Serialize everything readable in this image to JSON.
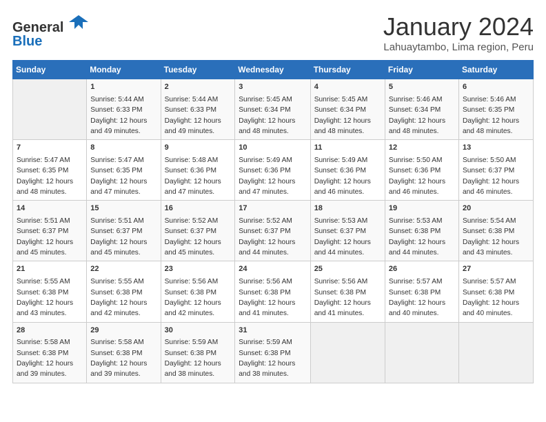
{
  "logo": {
    "line1": "General",
    "line2": "Blue"
  },
  "header": {
    "title": "January 2024",
    "subtitle": "Lahuaytambo, Lima region, Peru"
  },
  "columns": [
    "Sunday",
    "Monday",
    "Tuesday",
    "Wednesday",
    "Thursday",
    "Friday",
    "Saturday"
  ],
  "weeks": [
    [
      {
        "day": "",
        "info": ""
      },
      {
        "day": "1",
        "info": "Sunrise: 5:44 AM\nSunset: 6:33 PM\nDaylight: 12 hours\nand 49 minutes."
      },
      {
        "day": "2",
        "info": "Sunrise: 5:44 AM\nSunset: 6:33 PM\nDaylight: 12 hours\nand 49 minutes."
      },
      {
        "day": "3",
        "info": "Sunrise: 5:45 AM\nSunset: 6:34 PM\nDaylight: 12 hours\nand 48 minutes."
      },
      {
        "day": "4",
        "info": "Sunrise: 5:45 AM\nSunset: 6:34 PM\nDaylight: 12 hours\nand 48 minutes."
      },
      {
        "day": "5",
        "info": "Sunrise: 5:46 AM\nSunset: 6:34 PM\nDaylight: 12 hours\nand 48 minutes."
      },
      {
        "day": "6",
        "info": "Sunrise: 5:46 AM\nSunset: 6:35 PM\nDaylight: 12 hours\nand 48 minutes."
      }
    ],
    [
      {
        "day": "7",
        "info": "Sunrise: 5:47 AM\nSunset: 6:35 PM\nDaylight: 12 hours\nand 48 minutes."
      },
      {
        "day": "8",
        "info": "Sunrise: 5:47 AM\nSunset: 6:35 PM\nDaylight: 12 hours\nand 47 minutes."
      },
      {
        "day": "9",
        "info": "Sunrise: 5:48 AM\nSunset: 6:36 PM\nDaylight: 12 hours\nand 47 minutes."
      },
      {
        "day": "10",
        "info": "Sunrise: 5:49 AM\nSunset: 6:36 PM\nDaylight: 12 hours\nand 47 minutes."
      },
      {
        "day": "11",
        "info": "Sunrise: 5:49 AM\nSunset: 6:36 PM\nDaylight: 12 hours\nand 46 minutes."
      },
      {
        "day": "12",
        "info": "Sunrise: 5:50 AM\nSunset: 6:36 PM\nDaylight: 12 hours\nand 46 minutes."
      },
      {
        "day": "13",
        "info": "Sunrise: 5:50 AM\nSunset: 6:37 PM\nDaylight: 12 hours\nand 46 minutes."
      }
    ],
    [
      {
        "day": "14",
        "info": "Sunrise: 5:51 AM\nSunset: 6:37 PM\nDaylight: 12 hours\nand 45 minutes."
      },
      {
        "day": "15",
        "info": "Sunrise: 5:51 AM\nSunset: 6:37 PM\nDaylight: 12 hours\nand 45 minutes."
      },
      {
        "day": "16",
        "info": "Sunrise: 5:52 AM\nSunset: 6:37 PM\nDaylight: 12 hours\nand 45 minutes."
      },
      {
        "day": "17",
        "info": "Sunrise: 5:52 AM\nSunset: 6:37 PM\nDaylight: 12 hours\nand 44 minutes."
      },
      {
        "day": "18",
        "info": "Sunrise: 5:53 AM\nSunset: 6:37 PM\nDaylight: 12 hours\nand 44 minutes."
      },
      {
        "day": "19",
        "info": "Sunrise: 5:53 AM\nSunset: 6:38 PM\nDaylight: 12 hours\nand 44 minutes."
      },
      {
        "day": "20",
        "info": "Sunrise: 5:54 AM\nSunset: 6:38 PM\nDaylight: 12 hours\nand 43 minutes."
      }
    ],
    [
      {
        "day": "21",
        "info": "Sunrise: 5:55 AM\nSunset: 6:38 PM\nDaylight: 12 hours\nand 43 minutes."
      },
      {
        "day": "22",
        "info": "Sunrise: 5:55 AM\nSunset: 6:38 PM\nDaylight: 12 hours\nand 42 minutes."
      },
      {
        "day": "23",
        "info": "Sunrise: 5:56 AM\nSunset: 6:38 PM\nDaylight: 12 hours\nand 42 minutes."
      },
      {
        "day": "24",
        "info": "Sunrise: 5:56 AM\nSunset: 6:38 PM\nDaylight: 12 hours\nand 41 minutes."
      },
      {
        "day": "25",
        "info": "Sunrise: 5:56 AM\nSunset: 6:38 PM\nDaylight: 12 hours\nand 41 minutes."
      },
      {
        "day": "26",
        "info": "Sunrise: 5:57 AM\nSunset: 6:38 PM\nDaylight: 12 hours\nand 40 minutes."
      },
      {
        "day": "27",
        "info": "Sunrise: 5:57 AM\nSunset: 6:38 PM\nDaylight: 12 hours\nand 40 minutes."
      }
    ],
    [
      {
        "day": "28",
        "info": "Sunrise: 5:58 AM\nSunset: 6:38 PM\nDaylight: 12 hours\nand 39 minutes."
      },
      {
        "day": "29",
        "info": "Sunrise: 5:58 AM\nSunset: 6:38 PM\nDaylight: 12 hours\nand 39 minutes."
      },
      {
        "day": "30",
        "info": "Sunrise: 5:59 AM\nSunset: 6:38 PM\nDaylight: 12 hours\nand 38 minutes."
      },
      {
        "day": "31",
        "info": "Sunrise: 5:59 AM\nSunset: 6:38 PM\nDaylight: 12 hours\nand 38 minutes."
      },
      {
        "day": "",
        "info": ""
      },
      {
        "day": "",
        "info": ""
      },
      {
        "day": "",
        "info": ""
      }
    ]
  ]
}
